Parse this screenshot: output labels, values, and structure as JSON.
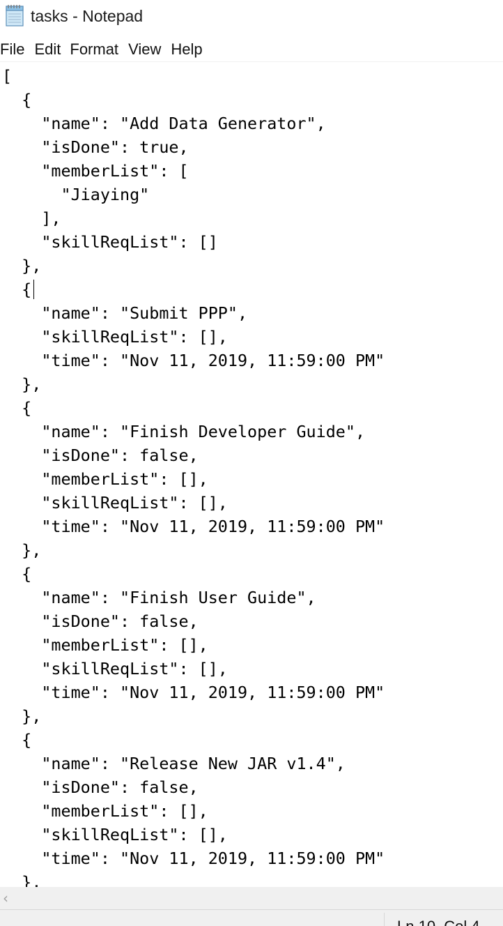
{
  "window": {
    "title": "tasks - Notepad",
    "app_icon": "notepad-icon"
  },
  "menu": {
    "items": [
      "File",
      "Edit",
      "Format",
      "View",
      "Help"
    ]
  },
  "editor": {
    "lines": [
      "[",
      "  {",
      "    \"name\": \"Add Data Generator\",",
      "    \"isDone\": true,",
      "    \"memberList\": [",
      "      \"Jiaying\"",
      "    ],",
      "    \"skillReqList\": []",
      "  },",
      "  {",
      "    \"name\": \"Submit PPP\",",
      "    \"skillReqList\": [],",
      "    \"time\": \"Nov 11, 2019, 11:59:00 PM\"",
      "  },",
      "  {",
      "    \"name\": \"Finish Developer Guide\",",
      "    \"isDone\": false,",
      "    \"memberList\": [],",
      "    \"skillReqList\": [],",
      "    \"time\": \"Nov 11, 2019, 11:59:00 PM\"",
      "  },",
      "  {",
      "    \"name\": \"Finish User Guide\",",
      "    \"isDone\": false,",
      "    \"memberList\": [],",
      "    \"skillReqList\": [],",
      "    \"time\": \"Nov 11, 2019, 11:59:00 PM\"",
      "  },",
      "  {",
      "    \"name\": \"Release New JAR v1.4\",",
      "    \"isDone\": false,",
      "    \"memberList\": [],",
      "    \"skillReqList\": [],",
      "    \"time\": \"Nov 11, 2019, 11:59:00 PM\"",
      "  },"
    ]
  },
  "scrollbar": {
    "left_arrow": "‹"
  },
  "status": {
    "position": "Ln 10, Col 4"
  }
}
